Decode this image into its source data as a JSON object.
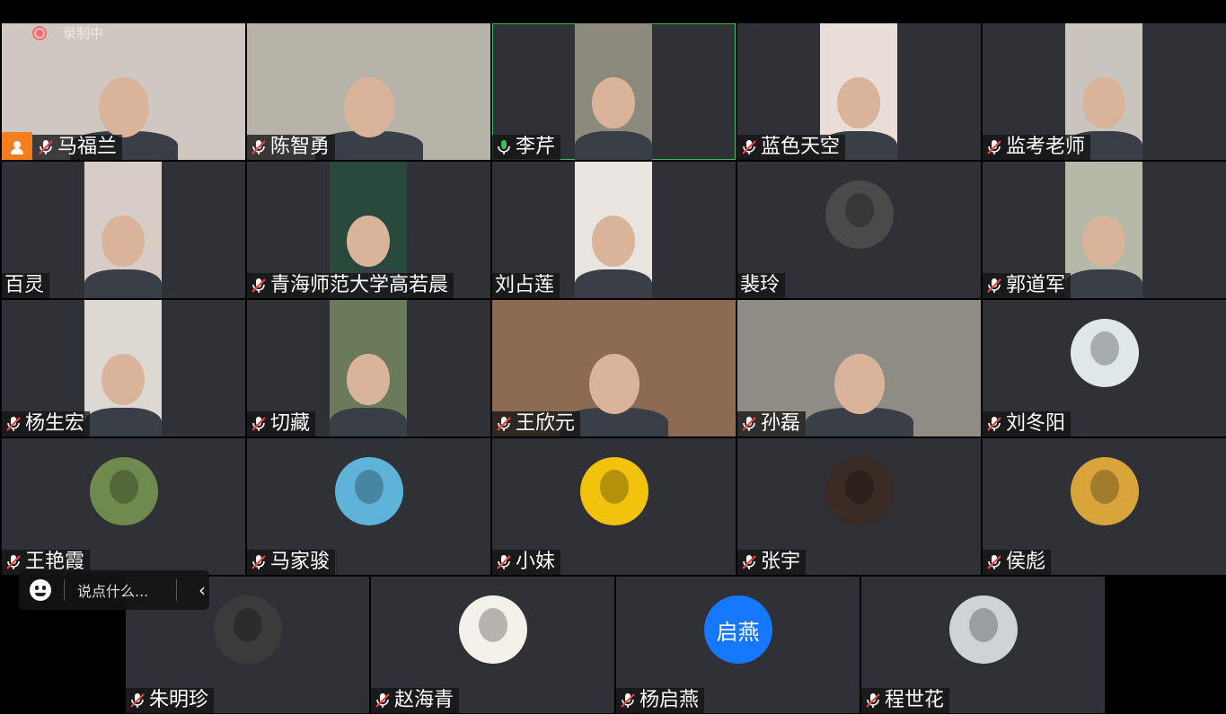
{
  "recording": {
    "label": "录制中"
  },
  "chat": {
    "placeholder": "说点什么..."
  },
  "participants": [
    {
      "name": "马福兰",
      "muted": true,
      "host": true,
      "kind": "video",
      "video_color": "#cfc7c2"
    },
    {
      "name": "陈智勇",
      "muted": true,
      "kind": "video",
      "video_color": "#b8b3a8"
    },
    {
      "name": "李芹",
      "muted": false,
      "speaking": true,
      "kind": "video",
      "video_color": "#8c8a7c"
    },
    {
      "name": "蓝色天空",
      "muted": true,
      "kind": "video",
      "video_color": "#e8ddd7"
    },
    {
      "name": "监考老师",
      "muted": true,
      "kind": "video",
      "video_color": "#c9c4bd"
    },
    {
      "name": "百灵",
      "muted": false,
      "kind": "video",
      "video_color": "#d7cdc6"
    },
    {
      "name": "青海师范大学高若晨",
      "muted": true,
      "kind": "video",
      "video_color": "#28493b"
    },
    {
      "name": "刘占莲",
      "muted": false,
      "kind": "video",
      "video_color": "#e9e4df"
    },
    {
      "name": "裴玲",
      "muted": false,
      "kind": "avatar",
      "avatar_color": "#4a4a4a"
    },
    {
      "name": "郭道军",
      "muted": true,
      "kind": "video",
      "video_color": "#b5b9a8"
    },
    {
      "name": "杨生宏",
      "muted": true,
      "kind": "video",
      "video_color": "#ddd8d1"
    },
    {
      "name": "切藏",
      "muted": true,
      "kind": "video",
      "video_color": "#6b7a5a"
    },
    {
      "name": "王欣元",
      "muted": true,
      "kind": "video",
      "video_color": "#8d6b52"
    },
    {
      "name": "孙磊",
      "muted": true,
      "kind": "video",
      "video_color": "#8f8c86"
    },
    {
      "name": "刘冬阳",
      "muted": true,
      "kind": "avatar",
      "avatar_color": "#dfe7ea"
    },
    {
      "name": "王艳霞",
      "muted": true,
      "kind": "avatar",
      "avatar_color": "#6f8a4d"
    },
    {
      "name": "马家骏",
      "muted": true,
      "kind": "avatar",
      "avatar_color": "#5fb3d9"
    },
    {
      "name": "小妹",
      "muted": true,
      "kind": "avatar",
      "avatar_color": "#f2c20c"
    },
    {
      "name": "张宇",
      "muted": true,
      "kind": "avatar",
      "avatar_color": "#3a2b24"
    },
    {
      "name": "侯彪",
      "muted": true,
      "kind": "avatar",
      "avatar_color": "#d9a53b"
    },
    {
      "name": "朱明珍",
      "muted": true,
      "kind": "avatar",
      "avatar_color": "#3b3b3b"
    },
    {
      "name": "赵海青",
      "muted": true,
      "kind": "avatar",
      "avatar_color": "#f4f1ea"
    },
    {
      "name": "杨启燕",
      "muted": true,
      "kind": "avatar-text",
      "avatar_text": "启燕",
      "avatar_color": "#1677ff"
    },
    {
      "name": "程世花",
      "muted": true,
      "kind": "avatar",
      "avatar_color": "#cfd3d6"
    }
  ],
  "colors": {
    "tile_bg": "#2f3136",
    "speaking_border": "#3dbb5a",
    "host_badge": "#f47d20",
    "muted_red": "#e84343"
  }
}
